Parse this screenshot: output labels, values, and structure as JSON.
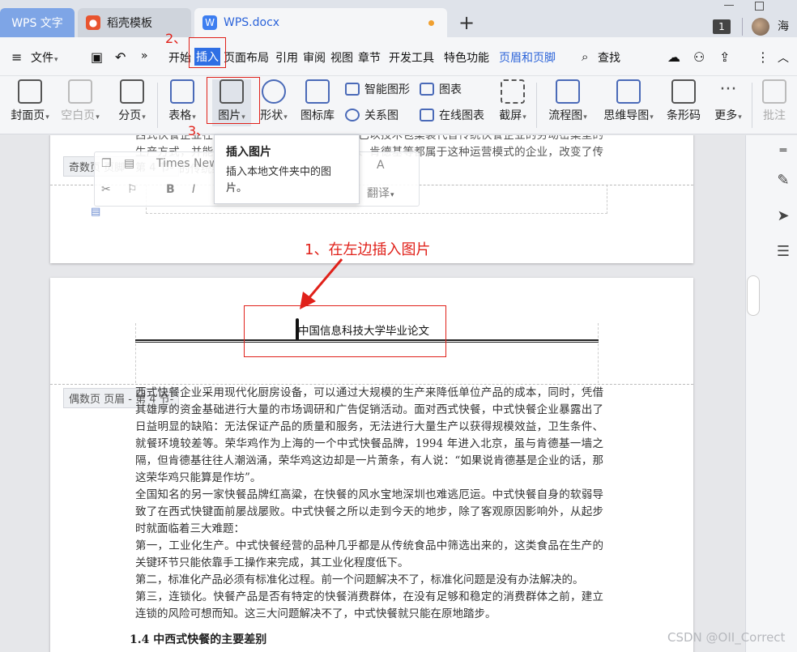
{
  "tabs": {
    "wps_label": "WPS 文字",
    "daoke_label": "稻壳模板",
    "doc_label": "WPS.docx",
    "counter": "1",
    "user": "海"
  },
  "menu": {
    "file": "文件",
    "items": [
      "开始",
      "插入",
      "页面布局",
      "引用",
      "审阅",
      "视图",
      "章节",
      "开发工具",
      "特色功能",
      "页眉和页脚"
    ],
    "search": "查找"
  },
  "ribbon": {
    "cover": "封面页",
    "blank": "空白页",
    "break": "分页",
    "table": "表格",
    "picture": "图片",
    "shape": "形状",
    "icon_lib": "图标库",
    "smart_art": "智能图形",
    "chart": "图表",
    "relation": "关系图",
    "online_chart": "在线图表",
    "screenshot": "截屏",
    "flowchart": "流程图",
    "mindmap": "思维导图",
    "barcode": "条形码",
    "more": "更多",
    "comment": "批注"
  },
  "annotations": {
    "step1": "1、在左边插入图片",
    "step2": "2、",
    "step3": "3、"
  },
  "tooltip": {
    "title": "插入图片",
    "body": "插入本地文件夹中的图片。"
  },
  "floatbar": {
    "font": "Times New",
    "translate": "翻译"
  },
  "page1": {
    "text": "西式快餐企业在管理上具有连锁经营为特点，已以技术包集装代替传统快餐企业的劳动密集型的生产方式，并能生产出标准化的产品，麦当劳、肯德基等都属于这种运营模式的企业，改变了传统快餐作的传统经营方式。西式快餐企业由",
    "odd_header_label": "奇数页 页脚 - 第 4 节-"
  },
  "page2": {
    "header_text": "中国信息科技大学毕业论文",
    "even_header_label": "偶数页 页眉 - 第 4 节-",
    "paragraphs": [
      "西式快餐企业采用现代化厨房设备，可以通过大规模的生产来降低单位产品的成本，同时，凭借其雄厚的资金基础进行大量的市场调研和广告促销活动。面对西式快餐，中式快餐企业暴露出了日益明显的缺陷：无法保证产品的质量和服务，无法进行大量生产以获得规模效益，卫生条件、就餐环境较差等。荣华鸡作为上海的一个中式快餐品牌，1994 年进入北京，虽与肯德基一墙之隔，但肯德基往往人潮汹涌，荣华鸡这边却是一片萧条，有人说：“如果说肯德基是企业的话，那这荣华鸡只能算是作坊”。",
      "全国知名的另一家快餐品牌红高粱，在快餐的风水宝地深圳也难逃厄运。中式快餐自身的软弱导致了在西式快键面前屡战屡败。中式快餐之所以走到今天的地步，除了客观原因影响外，从起步时就面临着三大难题：",
      "第一，工业化生产。中式快餐经营的品种几乎都是从传统食品中筛选出来的，这类食品在生产的关键环节只能依靠手工操作来完成，其工业化程度低下。",
      "第二，标准化产品必须有标准化过程。前一个问题解决不了，标准化问题是没有办法解决的。",
      "第三，连锁化。快餐产品是否有特定的快餐消费群体，在没有足够和稳定的消费群体之前，建立连锁的风险可想而知。这三大问题解决不了，中式快餐就只能在原地踏步。"
    ],
    "heading": "1.4 中西式快餐的主要差别"
  },
  "watermark": "CSDN @OII_Correct",
  "colors": {
    "accent": "#2f6fe4",
    "annotation": "#e0211a"
  }
}
